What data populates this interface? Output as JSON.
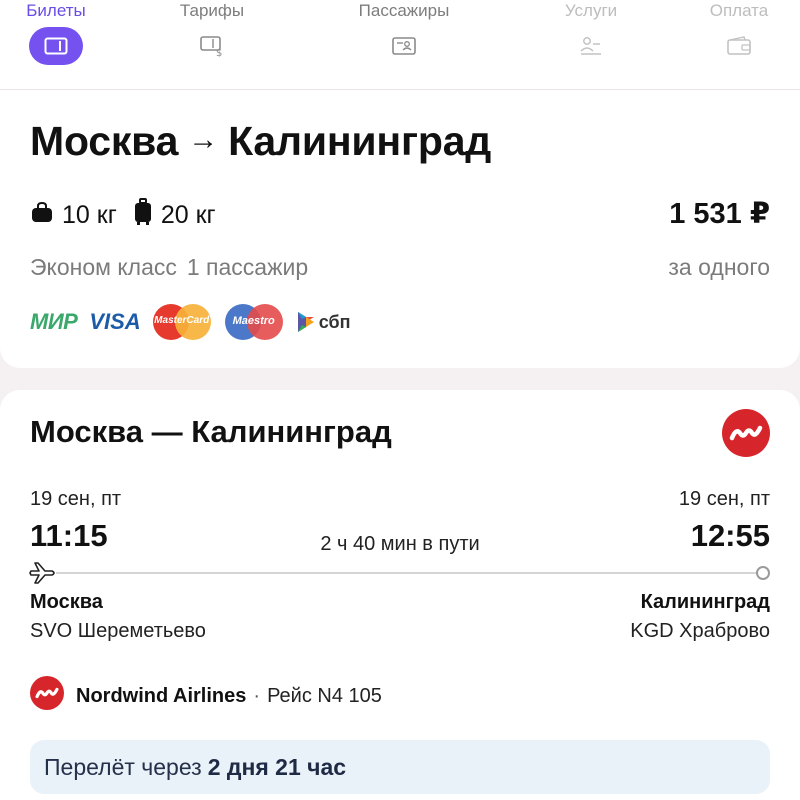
{
  "stepper": {
    "steps": [
      {
        "label": "Билеты",
        "state": "active",
        "icon": "ticket-icon"
      },
      {
        "label": "Тарифы",
        "state": "normal",
        "icon": "tariff-icon"
      },
      {
        "label": "Пассажиры",
        "state": "normal",
        "icon": "passenger-card-icon"
      },
      {
        "label": "Услуги",
        "state": "disabled",
        "icon": "services-icon"
      },
      {
        "label": "Оплата",
        "state": "disabled",
        "icon": "wallet-icon"
      }
    ],
    "active_color": "#7552f0"
  },
  "summary": {
    "origin": "Москва",
    "arrow": "→",
    "destination": "Калининград",
    "hand_luggage": "10 кг",
    "checked_luggage": "20 кг",
    "price": "1 531 ₽",
    "cabin_class": "Эконом класс",
    "passengers": "1 пассажир",
    "price_note": "за одного",
    "payment_methods": {
      "mir": "МИР",
      "visa": "VISA",
      "mastercard": "MasterCard",
      "maestro": "Maestro",
      "sbp": "сбп"
    }
  },
  "flight": {
    "title": "Москва — Калининград",
    "departure": {
      "date": "19 сен, пт",
      "time": "11:15",
      "city": "Москва",
      "airport": "SVO Шереметьево"
    },
    "arrival": {
      "date": "19 сен, пт",
      "time": "12:55",
      "city": "Калининград",
      "airport": "KGD Храброво"
    },
    "duration": "2 ч 40 мин в пути",
    "airline": "Nordwind Airlines",
    "separator": "·",
    "flight_number": "Рейс N4 105",
    "airline_color": "#d7262b",
    "notice_prefix": "Перелёт через",
    "notice_bold": "2 дня 21 час"
  }
}
